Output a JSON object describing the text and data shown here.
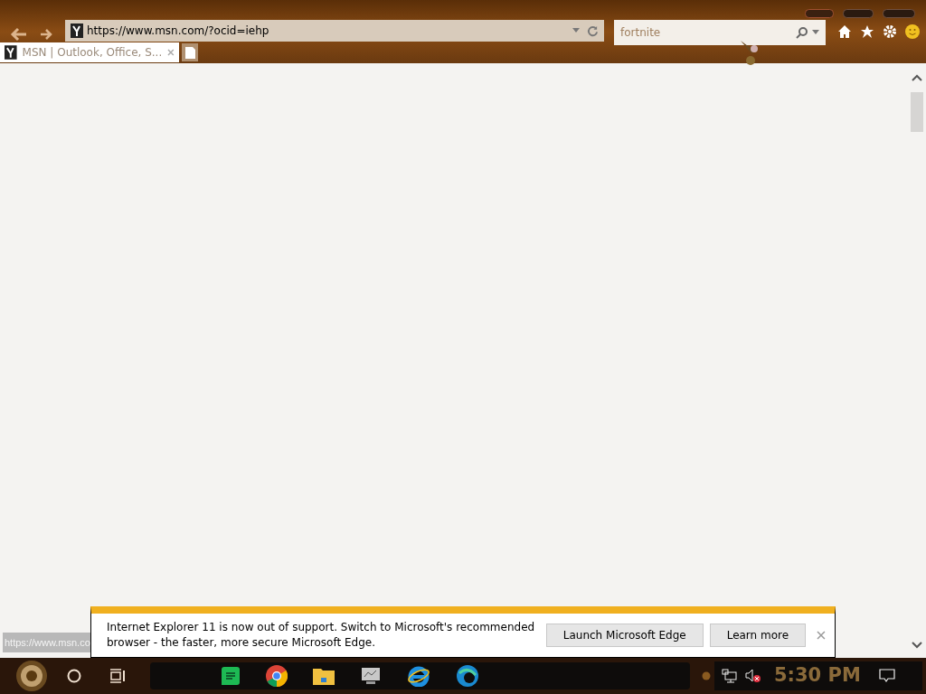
{
  "address_bar": {
    "url": "https://www.msn.com/?ocid=iehp"
  },
  "search": {
    "value": "fortnite"
  },
  "tabs": [
    {
      "title": "MSN | Outlook, Office, S...",
      "selected": true
    }
  ],
  "status_url": "https://www.msn.co",
  "notification": {
    "message": "Internet Explorer 11 is now out of support. Switch to Microsoft's recommended browser - the faster, more secure Microsoft Edge.",
    "buttons": [
      "Launch Microsoft Edge",
      "Learn more"
    ]
  },
  "taskbar": {
    "clock": "5:30 PM",
    "volume_muted": true
  }
}
